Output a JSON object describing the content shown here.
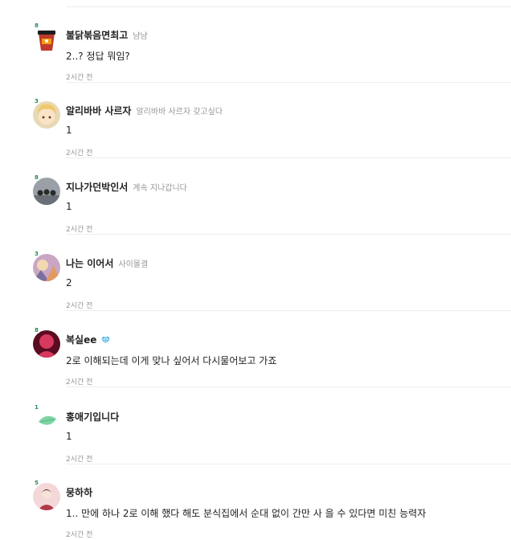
{
  "comments": [
    {
      "nickname": "불닭볶음면최고",
      "sub": "냠냠",
      "text": "2..? 정답 뭐임?",
      "time": "2시간 전",
      "level": "8",
      "avatar": "ramen-cup",
      "colors": [
        "#c0392b",
        "#1c1c1c"
      ]
    },
    {
      "nickname": "알리바바 사르자",
      "sub": "알리바바 사르자 갖고싶다",
      "text": "1",
      "time": "2시간 전",
      "level": "3",
      "avatar": "anime-character",
      "colors": [
        "#f0c869",
        "#5a4a36"
      ]
    },
    {
      "nickname": "지나가던박인서",
      "sub": "계속 지나갑니다",
      "text": "1",
      "time": "2시간 전",
      "level": "8",
      "avatar": "group-photo",
      "colors": [
        "#9aa0a8",
        "#2a2a2a"
      ]
    },
    {
      "nickname": "나는 이어서",
      "sub": "사이몰결",
      "text": "2",
      "time": "2시간 전",
      "level": "3",
      "avatar": "illustration",
      "colors": [
        "#c9a7c4",
        "#7c6fa0"
      ]
    },
    {
      "nickname": "복실ee",
      "sub": "",
      "text": "2로 이해되는데 이게 맞나 싶어서 다시물어보고 가죠",
      "time": "2시간 전",
      "level": "8",
      "avatar": "pink-photo",
      "badge": "diamond-badge",
      "colors": [
        "#d63a5e",
        "#5a0c22"
      ]
    },
    {
      "nickname": "홍애기입니다",
      "sub": "",
      "text": "1",
      "time": "2시간 전",
      "level": "1",
      "avatar": "green-leaf",
      "colors": [
        "#7fd3a4",
        "#4fbd85"
      ]
    },
    {
      "nickname": "뭉하하",
      "sub": "",
      "text": "1.. 만에 하나 2로 이해 했다 해도 분식집에서 순대 없이 간만 사 을 수 있다면 미친 능력자",
      "time": "2시간 전",
      "level": "5",
      "avatar": "person-photo",
      "colors": [
        "#f4d7d9",
        "#b03a4a"
      ]
    }
  ]
}
